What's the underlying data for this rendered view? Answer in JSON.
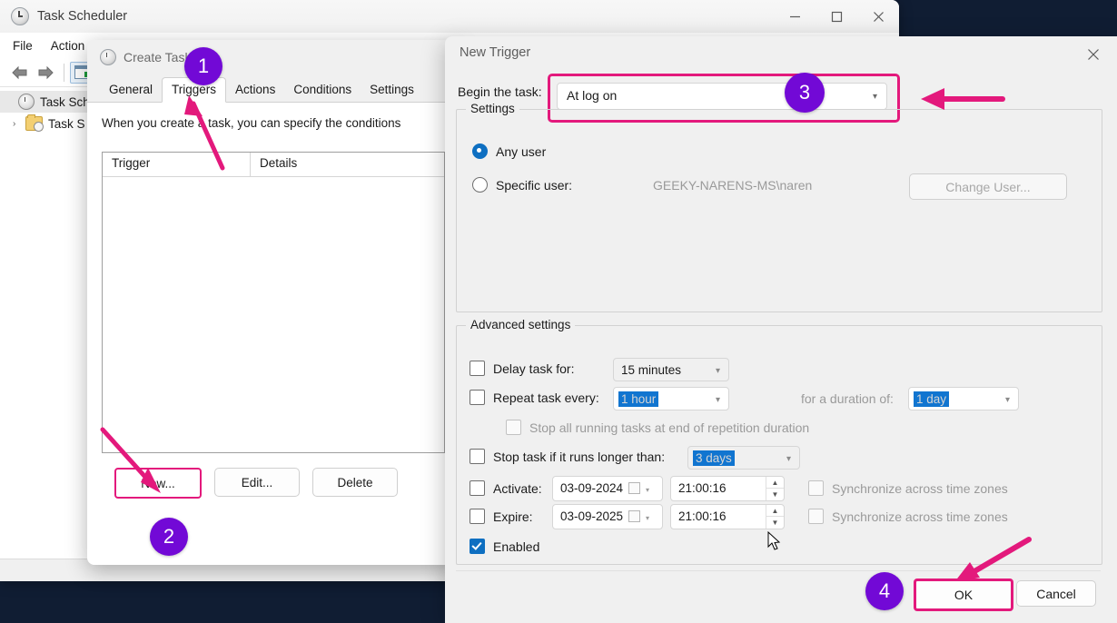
{
  "main_window": {
    "title": "Task Scheduler",
    "menu": [
      "File",
      "Action"
    ],
    "window_buttons": [
      "minimize",
      "maximize",
      "close"
    ],
    "tree": [
      {
        "label": "Task Sche",
        "icon": "clock-icon",
        "selected": true
      },
      {
        "label": "Task S",
        "icon": "folder-clock-icon",
        "selected": false,
        "chevron": "›"
      }
    ]
  },
  "create_task": {
    "title": "Create Task",
    "tabs": [
      {
        "label": "General",
        "active": false
      },
      {
        "label": "Triggers",
        "active": true
      },
      {
        "label": "Actions",
        "active": false
      },
      {
        "label": "Conditions",
        "active": false
      },
      {
        "label": "Settings",
        "active": false
      }
    ],
    "description": "When you create a task, you can specify the conditions",
    "list_headers": [
      "Trigger",
      "Details"
    ],
    "buttons": [
      {
        "label": "New...",
        "highlighted": true
      },
      {
        "label": "Edit...",
        "highlighted": false
      },
      {
        "label": "Delete",
        "highlighted": false
      }
    ]
  },
  "new_trigger": {
    "title": "New Trigger",
    "begin_label": "Begin the task:",
    "begin_value": "At log on",
    "settings": {
      "legend": "Settings",
      "any_user_label": "Any user",
      "any_user_selected": true,
      "specific_user_label": "Specific user:",
      "specific_user_selected": false,
      "specific_user_value": "GEEKY-NARENS-MS\\naren",
      "change_user_button": "Change User..."
    },
    "advanced": {
      "legend": "Advanced settings",
      "delay_task_label": "Delay task for:",
      "delay_task_checked": false,
      "delay_task_value": "15 minutes",
      "repeat_task_label": "Repeat task every:",
      "repeat_task_checked": false,
      "repeat_task_value": "1 hour",
      "duration_label": "for a duration of:",
      "duration_value": "1 day",
      "stop_all_label": "Stop all running tasks at end of repetition duration",
      "stop_all_checked": false,
      "stop_task_label": "Stop task if it runs longer than:",
      "stop_task_checked": false,
      "stop_task_value": "3 days",
      "activate_label": "Activate:",
      "activate_checked": false,
      "activate_date": "03-09-2024",
      "activate_time": "21:00:16",
      "expire_label": "Expire:",
      "expire_checked": false,
      "expire_date": "03-09-2025",
      "expire_time": "21:00:16",
      "sync_label": "Synchronize across time zones",
      "sync_activate_checked": false,
      "sync_expire_checked": false,
      "enabled_label": "Enabled",
      "enabled_checked": true
    },
    "footer_buttons": [
      {
        "label": "OK",
        "highlighted": true
      },
      {
        "label": "Cancel",
        "highlighted": false
      }
    ]
  },
  "annotations": {
    "badges": [
      {
        "number": "1",
        "target": "triggers-tab"
      },
      {
        "number": "2",
        "target": "new-button"
      },
      {
        "number": "3",
        "target": "begin-the-task-combo"
      },
      {
        "number": "4",
        "target": "ok-button"
      }
    ],
    "accent_color": "#e3197c",
    "badge_color": "#7209d6"
  }
}
